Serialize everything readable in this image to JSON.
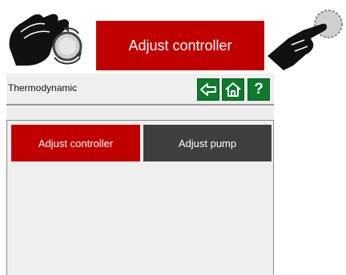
{
  "banner": {
    "action_label": "Adjust controller",
    "left_icon": "hand-turning-knob-icon",
    "right_icon": "hand-pressing-button-icon"
  },
  "screen": {
    "title": "Thermodynamic",
    "nav": {
      "back_icon": "arrow-left-icon",
      "home_icon": "home-icon",
      "help_label": "?"
    },
    "tabs": [
      {
        "label": "Adjust controller",
        "active": true
      },
      {
        "label": "Adjust pump",
        "active": false
      }
    ]
  },
  "colors": {
    "accent_red": "#c00000",
    "nav_green": "#0e7a2c",
    "inactive_tab": "#3f3f3f"
  }
}
